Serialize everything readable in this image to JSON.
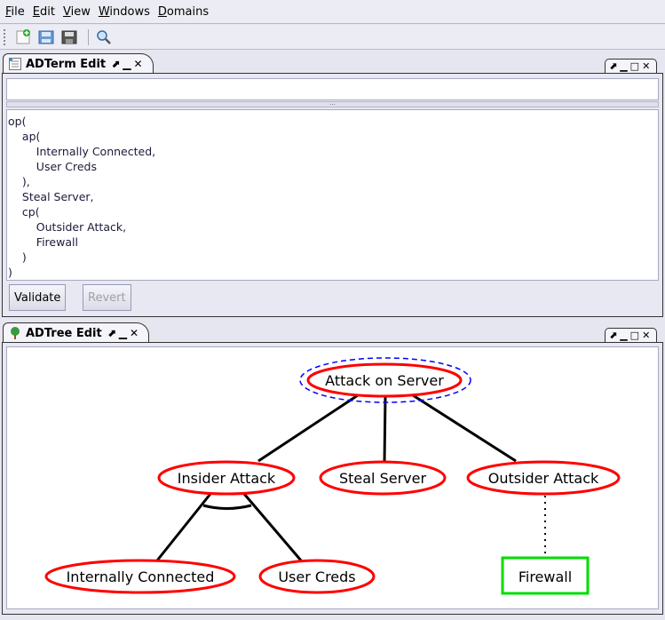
{
  "menubar": {
    "items": [
      {
        "label": "File",
        "mn": "F",
        "rest": "ile"
      },
      {
        "label": "Edit",
        "mn": "E",
        "rest": "dit"
      },
      {
        "label": "View",
        "mn": "V",
        "rest": "iew"
      },
      {
        "label": "Windows",
        "mn": "W",
        "rest": "indows"
      },
      {
        "label": "Domains",
        "mn": "D",
        "rest": "omains"
      }
    ]
  },
  "toolbar": {
    "icons": [
      "new-file-icon",
      "save-all-icon",
      "save-icon",
      "search-icon"
    ]
  },
  "adterm": {
    "tab_label": "ADTerm Edit",
    "input_value": "",
    "lines": [
      [
        "",
        "op("
      ],
      [
        "    ",
        "ap("
      ],
      [
        "        ",
        "Internally Connected,"
      ],
      [
        "        ",
        "User Creds"
      ],
      [
        "    ",
        "),"
      ],
      [
        "    ",
        "Steal Server,"
      ],
      [
        "    ",
        "cp("
      ],
      [
        "        ",
        "Outsider Attack,"
      ],
      [
        "        ",
        "Firewall"
      ],
      [
        "    ",
        ")"
      ],
      [
        "",
        ")"
      ]
    ],
    "validate_label": "Validate",
    "revert_label": "Revert"
  },
  "adtree": {
    "tab_label": "ADTree Edit",
    "nodes": {
      "root": "Attack on Server",
      "insider": "Insider Attack",
      "steal": "Steal Server",
      "outsider": "Outsider Attack",
      "internally": "Internally Connected",
      "creds": "User Creds",
      "firewall": "Firewall"
    },
    "colors": {
      "attack": "#ff0000",
      "defense": "#00dd00",
      "selected": "#0000ff"
    }
  }
}
